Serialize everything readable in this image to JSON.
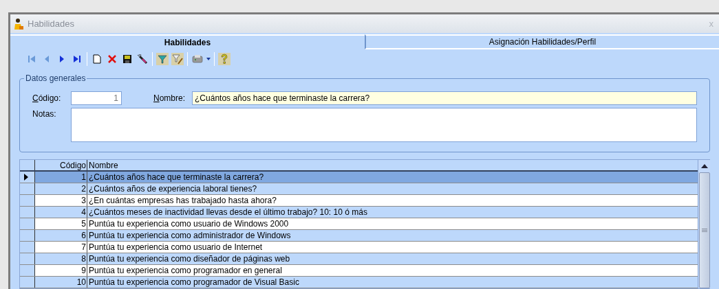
{
  "window": {
    "title": "Habilidades",
    "close": "x"
  },
  "tabs": [
    {
      "label": "Habilidades",
      "selected": true
    },
    {
      "label": "Asignación Habilidades/Perfil",
      "selected": false
    }
  ],
  "group": {
    "title": "Datos generales",
    "code_label": "Código:",
    "code_value": "1",
    "name_label": "Nombre:",
    "name_value": "¿Cuántos años hace que terminaste la carrera?",
    "notes_label": "Notas:"
  },
  "table": {
    "columns": [
      "Código",
      "Nombre"
    ],
    "rows": [
      {
        "code": "1",
        "name": "¿Cuántos años hace que terminaste la carrera?",
        "selected": true
      },
      {
        "code": "2",
        "name": "¿Cuántos años de experiencia laboral tienes?",
        "selected": false
      },
      {
        "code": "3",
        "name": "¿En cuántas empresas has trabajado hasta ahora?",
        "selected": false
      },
      {
        "code": "4",
        "name": "¿Cuántos meses de inactividad llevas desde el último trabajo? 10: 10 ó más",
        "selected": false
      },
      {
        "code": "5",
        "name": "Puntúa tu experiencia como usuario de Windows 2000",
        "selected": false
      },
      {
        "code": "6",
        "name": "Puntúa tu experiencia como administrador de Windows",
        "selected": false
      },
      {
        "code": "7",
        "name": "Puntúa tu experiencia como usuario de Internet",
        "selected": false
      },
      {
        "code": "8",
        "name": "Puntúa tu experiencia como diseñador de páginas web",
        "selected": false
      },
      {
        "code": "9",
        "name": "Puntúa tu experiencia como programador en general",
        "selected": false
      },
      {
        "code": "10",
        "name": "Puntúa tu experiencia como programador de Visual Basic",
        "selected": false
      }
    ]
  }
}
